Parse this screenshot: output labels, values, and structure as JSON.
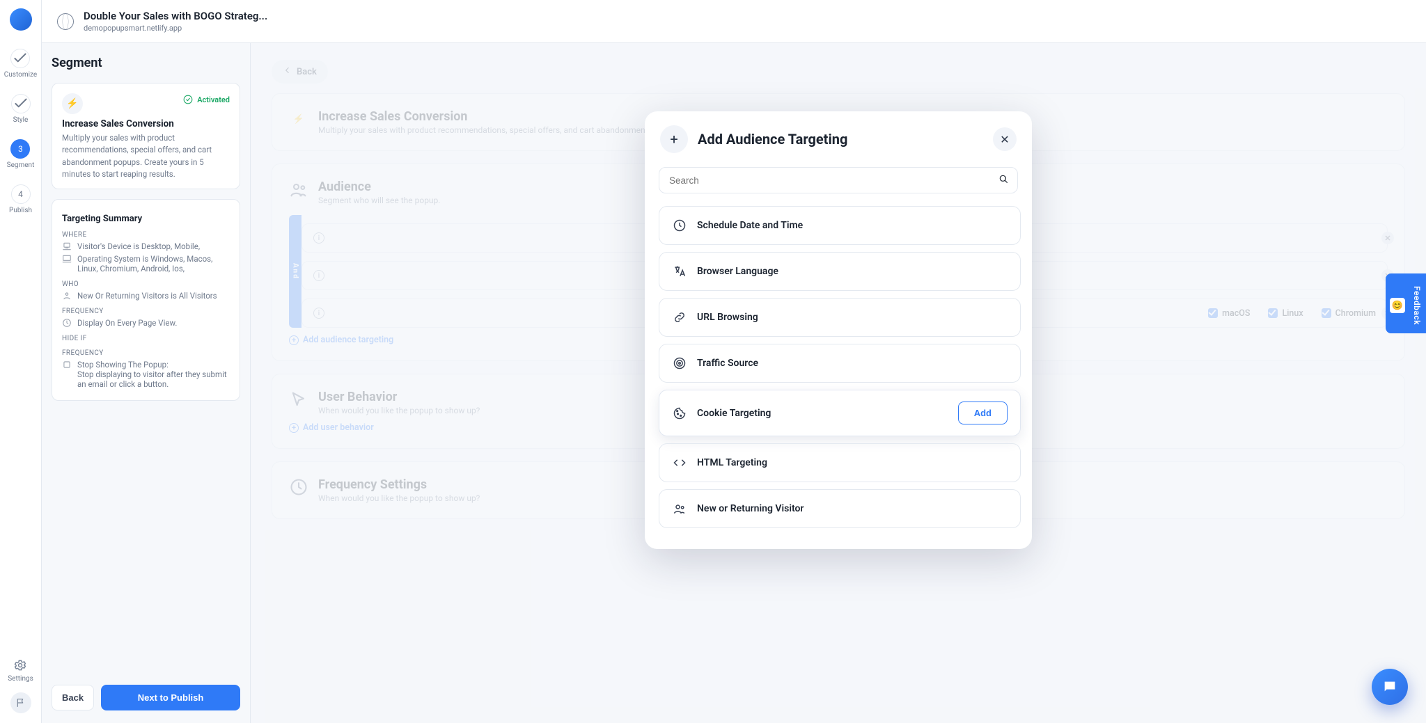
{
  "topbar": {
    "title": "Double Your Sales with BOGO Strateg...",
    "subtitle": "demopopupsmart.netlify.app"
  },
  "rail": {
    "steps": [
      {
        "label": "Customize",
        "done": true
      },
      {
        "label": "Style",
        "done": true
      },
      {
        "label": "Segment",
        "num": "3",
        "active": true
      },
      {
        "label": "Publish",
        "num": "4"
      }
    ],
    "settings_label": "Settings"
  },
  "left": {
    "heading": "Segment",
    "activated_label": "Activated",
    "template_title": "Increase Sales Conversion",
    "template_desc": "Multiply your sales with product recommendations, special offers, and cart abandonment popups. Create yours in 5 minutes to start reaping results.",
    "summary_title": "Targeting Summary",
    "sections": {
      "where_label": "WHERE",
      "where_rows": [
        "Visitor's Device is Desktop, Mobile,",
        "Operating System is Windows, Macos, Linux, Chromium, Android, Ios,"
      ],
      "who_label": "WHO",
      "who_rows": [
        "New Or Returning Visitors is All Visitors"
      ],
      "freq_label": "FREQUENCY",
      "freq_rows": [
        "Display On Every Page View."
      ],
      "hide_label": "Hide if",
      "freq2_label": "FREQUENCY",
      "freq2_rows": [
        "Stop Showing The Popup:",
        "Stop displaying to visitor after they submit an email or click a button."
      ]
    },
    "back_label": "Back",
    "next_label": "Next to Publish"
  },
  "preview": {
    "back_btn": "Back",
    "hero_title": "Increase Sales Conversion",
    "hero_desc": "Multiply your sales with product recommendations, special offers, and cart abandonment popups. Create yours in 5 minutes to start reaping results.",
    "audience_title": "Audience",
    "audience_sub": "Segment who will see the popup.",
    "rule_labels": [
      "",
      "",
      ""
    ],
    "and_label": "And",
    "os_options": [
      "macOS",
      "Linux",
      "Chromium"
    ],
    "add_audience_link": "Add audience targeting",
    "user_title": "User Behavior",
    "user_sub": "When would you like the popup to show up?",
    "add_user_link": "Add user behavior",
    "freq_title": "Frequency Settings",
    "freq_sub": "When would you like the popup to show up?"
  },
  "modal": {
    "title": "Add Audience Targeting",
    "search_placeholder": "Search",
    "add_btn": "Add",
    "options": [
      "Schedule Date and Time",
      "Browser Language",
      "URL Browsing",
      "Traffic Source",
      "Cookie Targeting",
      "HTML Targeting",
      "New or Returning Visitor"
    ],
    "highlight_index": 4
  },
  "feedback_label": "Feedback"
}
